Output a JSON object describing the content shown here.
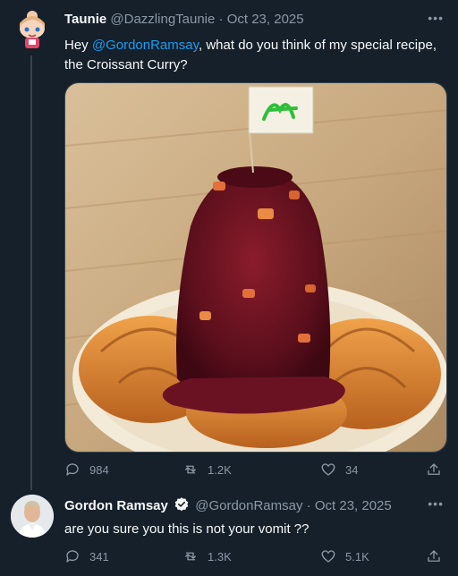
{
  "tweet1": {
    "name": "Taunie",
    "handle": "@DazzlingTaunie",
    "separator": "·",
    "date": "Oct 23, 2025",
    "more": "•••",
    "text_prefix": "Hey ",
    "mention": "@GordonRamsay",
    "text_suffix": ", what do you think of my special recipe, the Croissant Curry?",
    "image_icon": "croissant-curry-image",
    "actions": {
      "replies": "984",
      "retweets": "1.2K",
      "likes": "34"
    }
  },
  "tweet2": {
    "name": "Gordon Ramsay",
    "handle": "@GordonRamsay",
    "separator": "·",
    "date": "Oct 23, 2025",
    "more": "•••",
    "text": "are you sure you this is not your vomit ??",
    "actions": {
      "replies": "341",
      "retweets": "1.3K",
      "likes": "5.1K"
    }
  },
  "colors": {
    "background": "#15202b",
    "text": "#f7f9f9",
    "muted": "#8b98a5",
    "link": "#1d9bf0",
    "border": "#38444d"
  }
}
